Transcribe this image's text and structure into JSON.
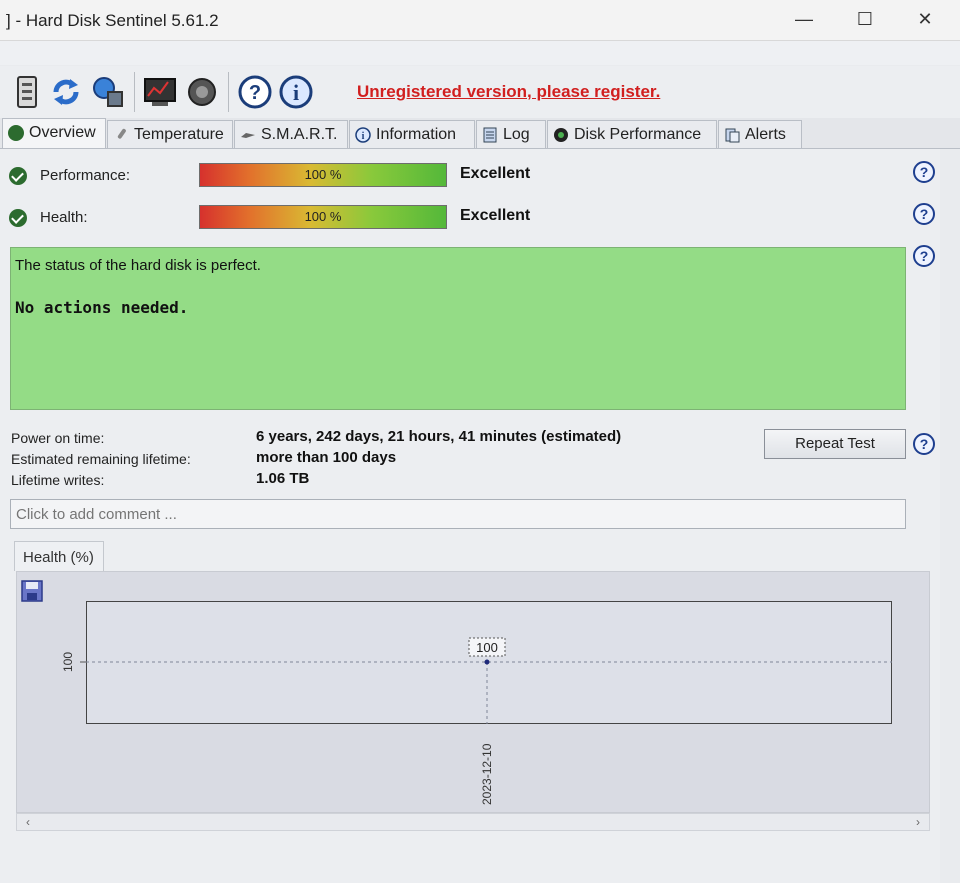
{
  "window": {
    "title": "] - Hard Disk Sentinel 5.61.2",
    "controls": {
      "minimize": "—",
      "maximize": "☐",
      "close": "✕"
    }
  },
  "menu_strip": {
    "text": ""
  },
  "toolbar": {
    "icons": [
      "disk-report-icon",
      "refresh-icon",
      "network-icon",
      "monitor-report-icon",
      "speaker-icon",
      "help-icon",
      "info-icon"
    ],
    "unregistered_text": "Unregistered version, please register."
  },
  "tabs": [
    {
      "label": "Overview",
      "icon": "check-icon",
      "active": true
    },
    {
      "label": "Temperature",
      "icon": "thermometer-icon",
      "active": false
    },
    {
      "label": "S.M.A.R.T.",
      "icon": "smart-icon",
      "active": false
    },
    {
      "label": "Information",
      "icon": "info-icon",
      "active": false
    },
    {
      "label": "Log",
      "icon": "log-icon",
      "active": false
    },
    {
      "label": "Disk Performance",
      "icon": "gauge-icon",
      "active": false
    },
    {
      "label": "Alerts",
      "icon": "alerts-icon",
      "active": false
    }
  ],
  "overview": {
    "performance": {
      "label": "Performance:",
      "percent_text": "100 %",
      "percent": 100,
      "rating": "Excellent"
    },
    "health": {
      "label": "Health:",
      "percent_text": "100 %",
      "percent": 100,
      "rating": "Excellent"
    },
    "status_line": "The status of the hard disk is perfect.",
    "status_action": "No actions needed.",
    "power_on_label": "Power on time:",
    "power_on_value": "6 years, 242 days, 21 hours, 41 minutes (estimated)",
    "remaining_label": "Estimated remaining lifetime:",
    "remaining_value": "more than 100 days",
    "writes_label": "Lifetime writes:",
    "writes_value": "1.06 TB",
    "repeat_test_label": "Repeat Test",
    "comment_placeholder": "Click to add comment ..."
  },
  "health_chart_tab": "Health (%)",
  "colors": {
    "status_green": "#94dc86",
    "unregistered_red": "#d11f1f",
    "help_blue": "#1e3f8f"
  },
  "chart_data": {
    "type": "line",
    "title": "Health (%)",
    "xlabel": "",
    "ylabel": "",
    "x": [
      "2023-12-10"
    ],
    "series": [
      {
        "values": [
          100
        ]
      }
    ],
    "y_ticks": [
      "100"
    ],
    "data_labels": [
      "100"
    ],
    "grid": true
  }
}
